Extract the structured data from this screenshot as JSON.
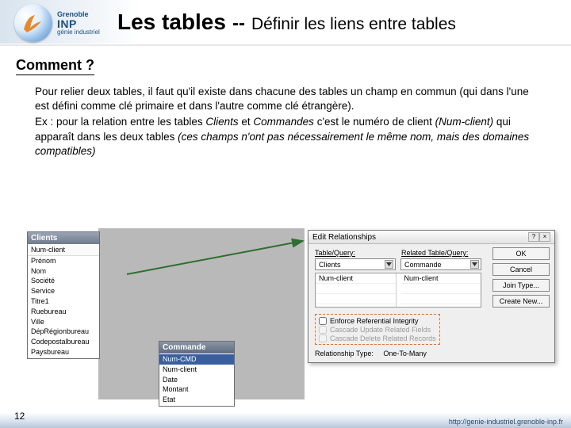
{
  "logo": {
    "line1": "Grenoble",
    "line2": "INP",
    "line3": "génie industriel"
  },
  "title": {
    "main": "Les tables",
    "sep": "--",
    "sub": "Définir les liens entre tables"
  },
  "section_heading": "Comment ?",
  "para1": "Pour relier deux tables, il faut qu'il existe dans chacune des tables un champ en commun (qui dans l'une est défini comme clé primaire et dans l'autre comme clé étrangère).",
  "para2_a": "Ex : pour la relation entre les tables ",
  "para2_clients": "Clients",
  "para2_b": " et ",
  "para2_commandes": "Commandes",
  "para2_c": " c'est le numéro de client ",
  "para2_numc": "(Num-client)",
  "para2_d": " qui apparaît dans les deux tables ",
  "para2_note": "(ces champs n'ont pas nécessairement le même nom, mais des domaines compatibles)",
  "tables": {
    "clients": {
      "title": "Clients",
      "fields": [
        "Num-client",
        "Prénom",
        "Nom",
        "Société",
        "Service",
        "Titre1",
        "Ruebureau",
        "Ville",
        "DépRégionbureau",
        "Codepostalbureau",
        "Paysbureau"
      ]
    },
    "commande": {
      "title": "Commande",
      "fields": [
        "Num-CMD",
        "Num-client",
        "Date",
        "Montant",
        "Etat"
      ]
    }
  },
  "dialog": {
    "title": "Edit Relationships",
    "label_left": "Table/Query:",
    "label_right": "Related Table/Query:",
    "combo_left": "Clients",
    "combo_right": "Commande",
    "grid_left": "Num-client",
    "grid_right": "Num-client",
    "chk1": "Enforce Referential Integrity",
    "chk2": "Cascade Update Related Fields",
    "chk3": "Cascade Delete Related Records",
    "reltype_label": "Relationship Type:",
    "reltype_value": "One-To-Many",
    "btn_ok": "OK",
    "btn_cancel": "Cancel",
    "btn_join": "Join Type...",
    "btn_new": "Create New..."
  },
  "page_number": "12",
  "footer_url": "http://genie-industriel.grenoble-inp.fr"
}
